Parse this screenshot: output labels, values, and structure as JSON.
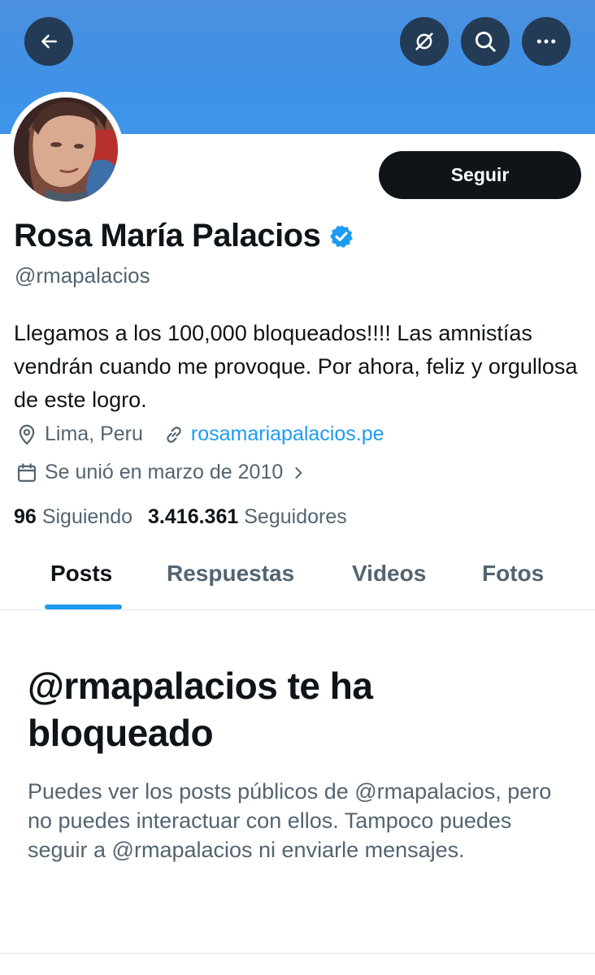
{
  "header": {
    "icons": [
      "back-arrow-icon",
      "notifications-off-icon",
      "search-icon",
      "more-icon"
    ]
  },
  "profile": {
    "avatar_icon": "profile-photo",
    "follow_label": "Seguir",
    "name": "Rosa María Palacios",
    "verified_icon": "verified-badge-icon",
    "handle": "@rmapalacios",
    "bio": "Llegamos a los 100,000 bloqueados!!!! Las amnistías vendrán cuando me provoque. Por ahora, feliz y orgullosa de este logro.",
    "location": "Lima, Peru",
    "website": "rosamariapalacios.pe",
    "joined": "Se unió en marzo de 2010",
    "following_count": "96",
    "following_label": "Siguiendo",
    "followers_count": "3.416.361",
    "followers_label": "Seguidores"
  },
  "tabs": [
    {
      "label": "Posts",
      "active": true
    },
    {
      "label": "Respuestas",
      "active": false
    },
    {
      "label": "Videos",
      "active": false
    },
    {
      "label": "Fotos",
      "active": false
    }
  ],
  "blocked": {
    "title": "@rmapalacios te ha bloqueado",
    "description": "Puedes ver los posts públicos de @rmapalacios, pero no puedes interactuar con ellos. Tampoco puedes seguir a @rmapalacios ni enviarle mensajes."
  },
  "colors": {
    "banner": "#4b8fe0",
    "accent": "#1d9bf0",
    "primary_text": "#0f1419",
    "secondary_text": "#536471"
  }
}
